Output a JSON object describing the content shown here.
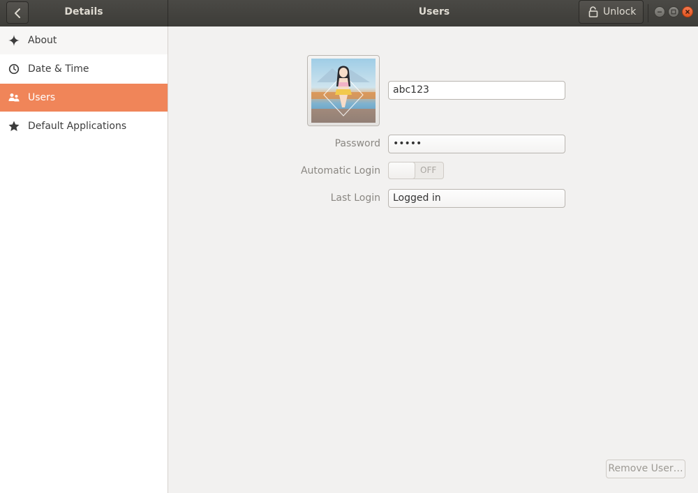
{
  "headerbar": {
    "left_title": "Details",
    "title": "Users",
    "unlock_label": "Unlock",
    "back_icon": "chevron-left-icon",
    "lock_icon": "lock-icon"
  },
  "window_controls": {
    "minimize_icon": "minimize-icon",
    "maximize_icon": "maximize-icon",
    "close_icon": "close-icon",
    "close_color": "#e95420"
  },
  "sidebar": {
    "items": [
      {
        "label": "About",
        "icon": "sparkle-icon",
        "selected": false
      },
      {
        "label": "Date & Time",
        "icon": "clock-icon",
        "selected": false
      },
      {
        "label": "Users",
        "icon": "users-icon",
        "selected": true
      },
      {
        "label": "Default Applications",
        "icon": "star-icon",
        "selected": false
      }
    ],
    "accent_color": "#f08559"
  },
  "user": {
    "name": "abc123",
    "password_label": "Password",
    "password_value": "•••••",
    "auto_login_label": "Automatic Login",
    "auto_login_state": "OFF",
    "last_login_label": "Last Login",
    "last_login_value": "Logged in"
  },
  "actions": {
    "remove_user_label": "Remove User…"
  }
}
